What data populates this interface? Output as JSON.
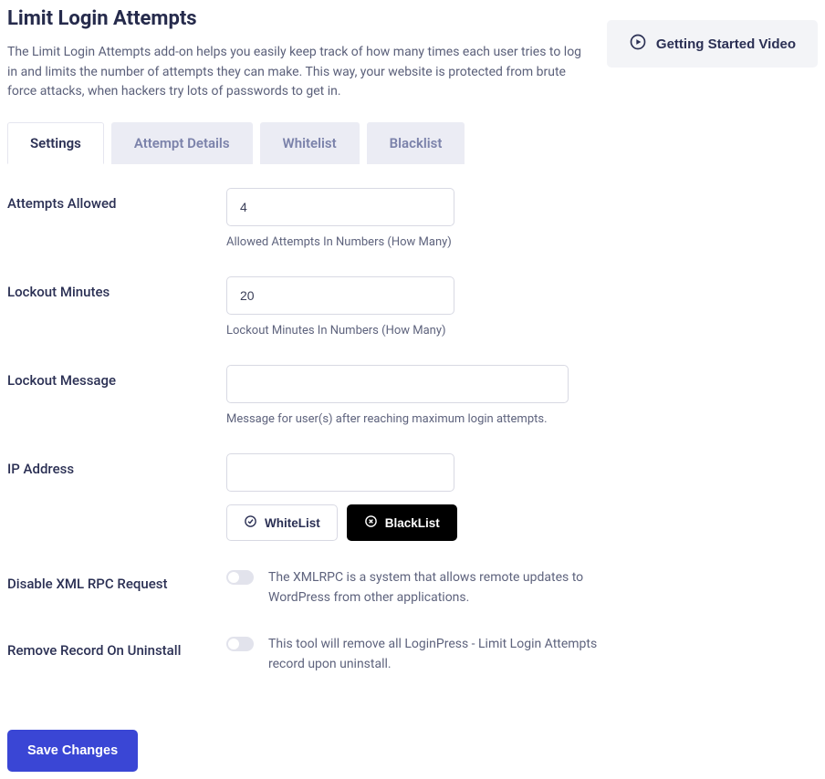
{
  "header": {
    "title": "Limit Login Attempts",
    "description": "The Limit Login Attempts add-on helps you easily keep track of how many times each user tries to log in and limits the number of attempts they can make. This way, your website is protected from brute force attacks, when hackers try lots of passwords to get in.",
    "video_button": "Getting Started Video"
  },
  "tabs": {
    "settings": "Settings",
    "attempt_details": "Attempt Details",
    "whitelist": "Whitelist",
    "blacklist": "Blacklist"
  },
  "form": {
    "attempts_allowed": {
      "label": "Attempts Allowed",
      "value": "4",
      "hint": "Allowed Attempts In Numbers (How Many)"
    },
    "lockout_minutes": {
      "label": "Lockout Minutes",
      "value": "20",
      "hint": "Lockout Minutes In Numbers (How Many)"
    },
    "lockout_message": {
      "label": "Lockout Message",
      "value": "",
      "hint": "Message for user(s) after reaching maximum login attempts."
    },
    "ip_address": {
      "label": "IP Address",
      "value": "",
      "whitelist_btn": "WhiteList",
      "blacklist_btn": "BlackList"
    },
    "disable_xml_rpc": {
      "label": "Disable XML RPC Request",
      "desc": "The XMLRPC is a system that allows remote updates to WordPress from other applications."
    },
    "remove_record": {
      "label": "Remove Record On Uninstall",
      "desc": "This tool will remove all LoginPress - Limit Login Attempts record upon uninstall."
    }
  },
  "actions": {
    "save": "Save Changes"
  }
}
